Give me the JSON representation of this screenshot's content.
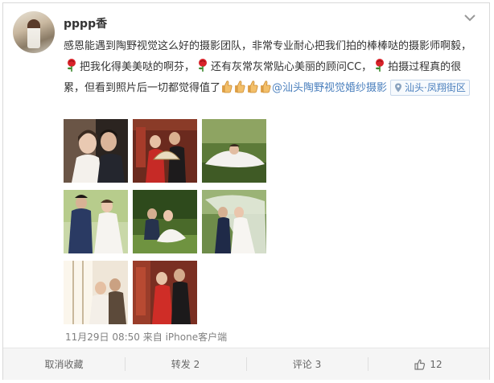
{
  "post": {
    "username": "pppp香",
    "text": {
      "seg1": "感恩能遇到陶野视觉这么好的摄影团队，非常专业耐心把我们拍的棒棒哒的摄影师啊毅，",
      "seg2": "把我化得美美哒的啊芬，",
      "seg3": "还有灰常灰常贴心美丽的顾问CC，",
      "seg4": "拍摄过程真的很累，但看到照片后一切都觉得值了",
      "mention": "@汕头陶野视觉婚纱摄影"
    },
    "location": "汕头·凤翔街区",
    "timestamp": "11月29日 08:50 来自 iPhone客户端",
    "photos": [
      {
        "name": "photo-1",
        "alt": "wedding couple portrait"
      },
      {
        "name": "photo-2",
        "alt": "couple in red traditional dress with fan"
      },
      {
        "name": "photo-3",
        "alt": "bride lying on grass"
      },
      {
        "name": "photo-4",
        "alt": "couple in garden"
      },
      {
        "name": "photo-5",
        "alt": "couple sitting on lawn"
      },
      {
        "name": "photo-6",
        "alt": "couple under veil"
      },
      {
        "name": "photo-7",
        "alt": "couple by window"
      },
      {
        "name": "photo-8",
        "alt": "couple in red traditional dress"
      }
    ]
  },
  "actions": {
    "unfavorite": "取消收藏",
    "repost": "转发 2",
    "comment": "评论 3",
    "like_count": "12"
  },
  "icons": {
    "menu": "chevron-down-icon",
    "location": "location-pin-icon",
    "like": "thumbs-up-icon",
    "rose": "rose-emoji-icon",
    "thumb": "thumbs-up-emoji-icon"
  },
  "colors": {
    "link": "#4a7fbd",
    "muted": "#808080",
    "action_bar": "#f5f5f5"
  }
}
